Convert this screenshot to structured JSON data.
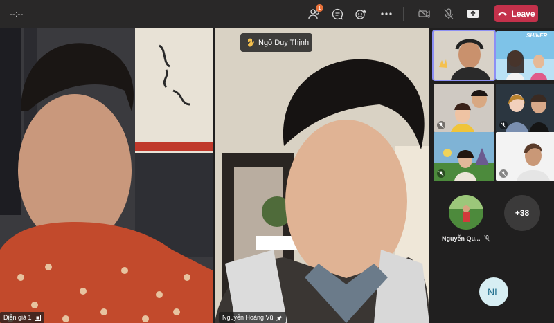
{
  "meeting": {
    "timer": "--:--"
  },
  "toolbar": {
    "participants_badge": "1",
    "leave_label": "Leave"
  },
  "stage": {
    "raised_hand_name": "Ngô Duy Thịnh",
    "left_tile_name": "Diễn giả 1",
    "right_tile_name": "Nguyễn Hoàng Vũ"
  },
  "rail": {
    "participant_name": "Nguyễn Qu...",
    "overflow_count": "+38",
    "initials_avatar": "NL",
    "thumb_label": "SHINER"
  },
  "colors": {
    "leave_button": "#c4314b",
    "active_border": "#8c8ff3",
    "badge": "#e8713a",
    "initials_bg": "#d7eef3",
    "initials_text": "#1f6e8c"
  },
  "icons": [
    "participants-icon",
    "chat-icon",
    "reactions-icon",
    "more-icon",
    "camera-off-icon",
    "mic-off-icon",
    "share-icon",
    "phone-icon",
    "raised-hand-icon",
    "pin-icon",
    "spotlight-icon"
  ]
}
